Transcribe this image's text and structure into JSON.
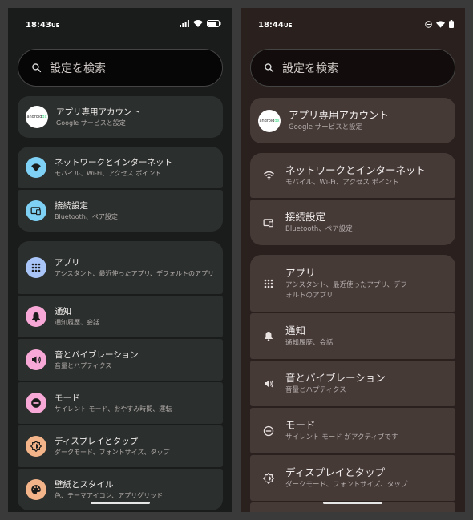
{
  "left": {
    "status": {
      "time": "18:43",
      "carrier": "UE"
    },
    "search": {
      "placeholder": "設定を検索"
    },
    "account": {
      "logo_text": "android",
      "logo_suffix": "dx",
      "title": "アプリ専用アカウント",
      "subtitle": "Google サービスと設定"
    },
    "items": [
      {
        "title": "ネットワークとインターネット",
        "subtitle": "モバイル、Wi-Fi、アクセス ポイント",
        "icon": "wifi-icon",
        "color": "#7ed0f5"
      },
      {
        "title": "接続設定",
        "subtitle": "Bluetooth、ペア設定",
        "icon": "devices-icon",
        "color": "#7ed0f5"
      },
      {
        "title": "アプリ",
        "subtitle": "アシスタント、最近使ったアプリ、デフォルトのアプリ",
        "icon": "apps-icon",
        "color": "#a9c4f7"
      },
      {
        "title": "通知",
        "subtitle": "通知履歴、会話",
        "icon": "bell-icon",
        "color": "#f7a8d6"
      },
      {
        "title": "音とバイブレーション",
        "subtitle": "音量とハプティクス",
        "icon": "speaker-icon",
        "color": "#f7a8d6"
      },
      {
        "title": "モード",
        "subtitle": "サイレント モード、おやすみ時間、運転",
        "icon": "do-not-disturb-icon",
        "color": "#f7a8d6"
      },
      {
        "title": "ディスプレイとタップ",
        "subtitle": "ダークモード、フォントサイズ、タップ",
        "icon": "brightness-icon",
        "color": "#f4b48a"
      },
      {
        "title": "壁紙とスタイル",
        "subtitle": "色、テーマアイコン、アプリグリッド",
        "icon": "palette-icon",
        "color": "#f4b48a"
      }
    ]
  },
  "right": {
    "status": {
      "time": "18:44",
      "carrier": "UE"
    },
    "search": {
      "placeholder": "設定を検索"
    },
    "account": {
      "logo_text": "android",
      "logo_suffix": "dx",
      "title": "アプリ専用アカウント",
      "subtitle": "Google サービスと設定"
    },
    "items": [
      {
        "title": "ネットワークとインターネット",
        "subtitle": "モバイル、Wi-Fi、アクセス ポイント",
        "icon": "wifi-icon"
      },
      {
        "title": "接続設定",
        "subtitle": "Bluetooth、ペア設定",
        "icon": "devices-icon"
      },
      {
        "title": "アプリ",
        "subtitle": "アシスタント、最近使ったアプリ、デフォルトのアプリ",
        "icon": "apps-icon"
      },
      {
        "title": "通知",
        "subtitle": "通知履歴、会話",
        "icon": "bell-icon"
      },
      {
        "title": "音とバイブレーション",
        "subtitle": "音量とハプティクス",
        "icon": "speaker-icon"
      },
      {
        "title": "モード",
        "subtitle": "サイレント モード がアクティブです",
        "icon": "do-not-disturb-icon"
      },
      {
        "title": "ディスプレイとタップ",
        "subtitle": "ダークモード、フォントサイズ、タップ",
        "icon": "brightness-icon"
      }
    ]
  }
}
